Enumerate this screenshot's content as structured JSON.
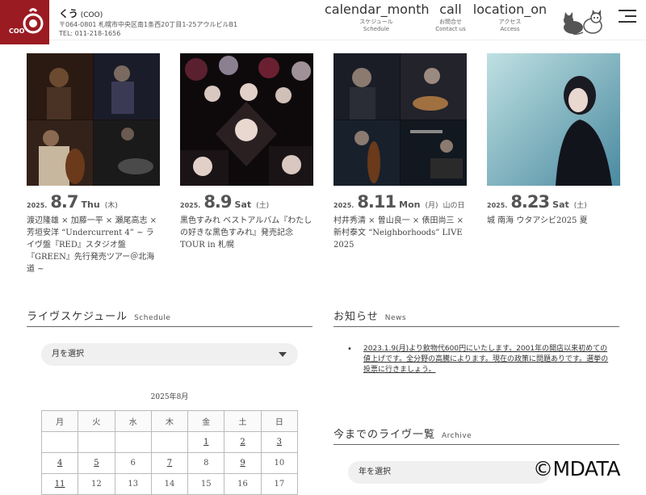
{
  "header": {
    "logo_text": "COO",
    "shop_name": "くう",
    "shop_name_en": "(COO)",
    "address": "〒064-0801 札幌市中央区南1条西20丁目1-25アウルビルB1",
    "tel": "TEL: 011-218-1656",
    "nav": [
      {
        "icon": "calendar_month",
        "jp": "スケジュール",
        "en": "Schedule"
      },
      {
        "icon": "call",
        "jp": "お問合せ",
        "en": "Contact us"
      },
      {
        "icon": "location_on",
        "jp": "アクセス",
        "en": "Access"
      }
    ]
  },
  "events": [
    {
      "year": "2025.",
      "md": "8.7",
      "dow": "Thu",
      "jpdow": "(木)",
      "holiday": "",
      "title": "渡辺隆雄 × 加藤一平 × 瀬尾高志 × 芳垣安洋 “Undercurrent 4” ~ ライヴ盤『RED』スタジオ盤『GREEN』先行発売ツアー＠北海道 ~"
    },
    {
      "year": "2025.",
      "md": "8.9",
      "dow": "Sat",
      "jpdow": "(土)",
      "holiday": "",
      "title": "黒色すみれ ベストアルバム『わたしの好きな黒色すみれ』発売記念TOUR in 札幌"
    },
    {
      "year": "2025.",
      "md": "8.11",
      "dow": "Mon",
      "jpdow": "(月)",
      "holiday": "山の日",
      "title": "村井秀清 × 曽山良一 × 俵田尚三 × 新村泰文 “Neighborhoods” LIVE 2025"
    },
    {
      "year": "2025.",
      "md": "8.23",
      "dow": "Sat",
      "jpdow": "(土)",
      "holiday": "",
      "title": "城 南海 ウタアシビ2025 夏"
    }
  ],
  "schedule": {
    "heading": "ライヴスケジュール",
    "heading_en": "Schedule",
    "select_label": "月を選択",
    "caption": "2025年8月",
    "weekdays": [
      "月",
      "火",
      "水",
      "木",
      "金",
      "土",
      "日"
    ],
    "rows": [
      [
        {
          "d": ""
        },
        {
          "d": ""
        },
        {
          "d": ""
        },
        {
          "d": ""
        },
        {
          "d": "1",
          "link": true
        },
        {
          "d": "2",
          "link": true
        },
        {
          "d": "3",
          "link": true
        }
      ],
      [
        {
          "d": "4",
          "link": true
        },
        {
          "d": "5",
          "link": true
        },
        {
          "d": "6"
        },
        {
          "d": "7",
          "link": true
        },
        {
          "d": "8"
        },
        {
          "d": "9",
          "link": true
        },
        {
          "d": "10"
        }
      ],
      [
        {
          "d": "11",
          "link": true
        },
        {
          "d": "12"
        },
        {
          "d": "13"
        },
        {
          "d": "14"
        },
        {
          "d": "15"
        },
        {
          "d": "16"
        },
        {
          "d": "17"
        }
      ]
    ]
  },
  "news": {
    "heading": "お知らせ",
    "heading_en": "News",
    "items": [
      "2023.1.9(月)より飲物代600円にいたします。2001年の開店以来初めての値上げです。全分野の高騰によります。現在の政策に問題ありです。選挙の投票に行きましょう。"
    ]
  },
  "archive": {
    "heading": "今までのライヴ一覧",
    "heading_en": "Archive",
    "select_label": "年を選択"
  },
  "watermark": "©MDATA"
}
